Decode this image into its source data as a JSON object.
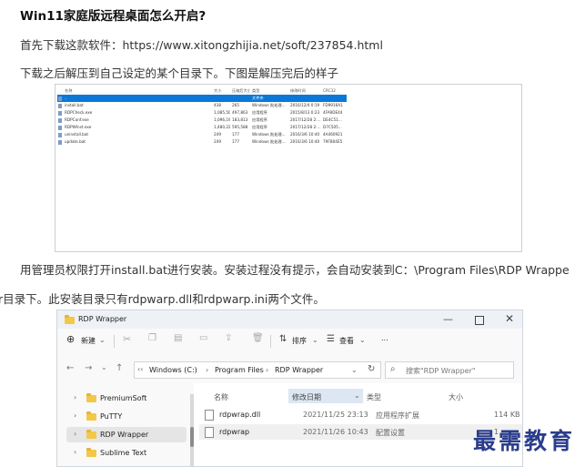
{
  "article": {
    "heading": "Win11家庭版远程桌面怎么开启?",
    "p1": "首先下载这款软件：https://www.xitongzhijia.net/soft/237854.html",
    "p2": "下载之后解压到自己设定的某个目录下。下图是解压完后的样子",
    "p3": "用管理员权限打开install.bat进行安装。安装过程没有提示，会自动安装到C：\\Program Files\\RDP Wrappe",
    "p4": "r目录下。此安装目录只有rdpwarp.dll和rdpwarp.ini两个文件。"
  },
  "archive_listing": {
    "columns": [
      "名称",
      "大小",
      "压缩后大小",
      "类型",
      "修改时间",
      "CRC32"
    ],
    "rows": [
      {
        "name": "..",
        "size": "",
        "packed": "",
        "type": "文件夹",
        "modified": "",
        "crc": ""
      },
      {
        "name": "install.bat",
        "size": "438",
        "packed": "265",
        "type": "Windows 批处理...",
        "modified": "2016/12/4 0:19",
        "crc": "FD9916A1"
      },
      {
        "name": "RDPCheck.exe",
        "size": "1,085,504",
        "packed": "497,863",
        "type": "应用程序",
        "modified": "2015/8/13 0:23",
        "crc": "4FA9DE44"
      },
      {
        "name": "RDPConf.exe",
        "size": "1,096,192",
        "packed": "183,813",
        "type": "应用程序",
        "modified": "2017/12/28 2:...",
        "crc": "DE4C51..."
      },
      {
        "name": "RDPWInst.exe",
        "size": "1,480,224",
        "packed": "595,588",
        "type": "应用程序",
        "modified": "2017/12/28 2:...",
        "crc": "D7C505..."
      },
      {
        "name": "uninstall.bat",
        "size": "249",
        "packed": "177",
        "type": "Windows 批处理...",
        "modified": "2016/3/6 10:40",
        "crc": "4A460921"
      },
      {
        "name": "update.bat",
        "size": "249",
        "packed": "177",
        "type": "Windows 批处理...",
        "modified": "2016/3/6 10:40",
        "crc": "79FB04E5"
      }
    ]
  },
  "explorer": {
    "title": "RDP Wrapper",
    "toolbar": {
      "new": "新建",
      "sort": "排序",
      "view": "查看",
      "more": "..."
    },
    "address": [
      "Windows (C:)",
      "Program Files",
      "RDP Wrapper"
    ],
    "search_placeholder": "搜索\"RDP Wrapper\"",
    "sidebar": [
      "PremiumSoft",
      "PuTTY",
      "RDP Wrapper",
      "Sublime Text"
    ],
    "columns": {
      "name": "名称",
      "date": "修改日期",
      "type": "类型",
      "size": "大小"
    },
    "files": [
      {
        "name": "rdpwrap.dll",
        "date": "2021/11/25 23:13",
        "type": "应用程序扩展",
        "size": "114 KB"
      },
      {
        "name": "rdpwrap",
        "date": "2021/11/26 10:43",
        "type": "配置设置",
        "size": "1"
      }
    ]
  },
  "watermark": "最需教育",
  "colors": {
    "selection": "#0a78d7",
    "folder": "#f2c84b",
    "watermark": "#2a3d8c"
  }
}
